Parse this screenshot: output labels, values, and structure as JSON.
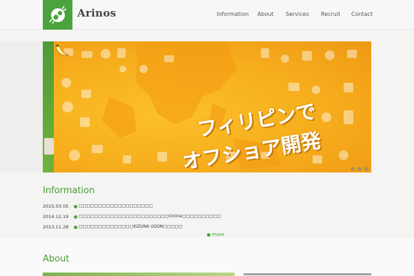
{
  "header": {
    "brand": "Arinos",
    "nav": [
      "Information",
      "About",
      "Services",
      "Recruit",
      "Contact"
    ]
  },
  "banner": {
    "line1": "フィリピンで",
    "line2": "オフショア開発",
    "slides": 3
  },
  "information": {
    "title": "Information",
    "items": [
      {
        "date": "2015.03.05",
        "text": "□□□□□□□□□□□□□□□□□□□"
      },
      {
        "date": "2014.12.19",
        "text": "□□□□□□□□□□□□□□□□□□□□□□□Online□□□□□□□□□□"
      },
      {
        "date": "2013.11.28",
        "text": "□□□□□□□□□□□□□□KIZUNA UDON□□□□□"
      }
    ],
    "more": "more"
  },
  "about": {
    "title": "About"
  },
  "colors": {
    "accent": "#4aa33c",
    "banner": "#f6ad1c"
  }
}
